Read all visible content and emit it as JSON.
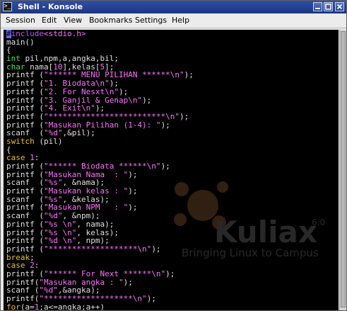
{
  "window": {
    "title": "Shell - Konsole",
    "app_icon": ">_"
  },
  "menubar": {
    "items": [
      "Session",
      "Edit",
      "View",
      "Bookmarks",
      "Settings",
      "Help"
    ]
  },
  "watermark": {
    "brand": "Kuliax",
    "version": "6.0",
    "tagline": "Bringing Linux to Campus"
  },
  "terminal": {
    "lines": [
      [
        [
          "pre-cursor",
          "#"
        ],
        [
          "pre",
          "include"
        ],
        [
          "str",
          "<stdio.h>"
        ]
      ],
      [
        [
          "plain",
          "main()"
        ]
      ],
      [
        [
          "plain",
          "{"
        ]
      ],
      [
        [
          "type",
          "int"
        ],
        [
          "plain",
          " pil,npm,a,angka,bil;"
        ]
      ],
      [
        [
          "type",
          "char"
        ],
        [
          "plain",
          " nama["
        ],
        [
          "num",
          "10"
        ],
        [
          "plain",
          "],kelas["
        ],
        [
          "num",
          "5"
        ],
        [
          "plain",
          "];"
        ]
      ],
      [
        [
          "plain",
          "printf ("
        ],
        [
          "str",
          "\"****** MENU PILIHAN ******\\n\""
        ],
        [
          "plain",
          ");"
        ]
      ],
      [
        [
          "plain",
          "printf ("
        ],
        [
          "str",
          "\"1. Biodata\\n\""
        ],
        [
          "plain",
          ");"
        ]
      ],
      [
        [
          "plain",
          "printf ("
        ],
        [
          "str",
          "\"2. For Nesxt\\n\""
        ],
        [
          "plain",
          ");"
        ]
      ],
      [
        [
          "plain",
          "printf ("
        ],
        [
          "str",
          "\"3. Ganjil & Genap\\n\""
        ],
        [
          "plain",
          ");"
        ]
      ],
      [
        [
          "plain",
          "printf ("
        ],
        [
          "str",
          "\"4. Exit\\n\""
        ],
        [
          "plain",
          ");"
        ]
      ],
      [
        [
          "plain",
          "printf ("
        ],
        [
          "str",
          "\"*************************\\n\""
        ],
        [
          "plain",
          ");"
        ]
      ],
      [
        [
          "plain",
          "printf ("
        ],
        [
          "str",
          "\"Masukan Pilihan (1-4): \""
        ],
        [
          "plain",
          ");"
        ]
      ],
      [
        [
          "plain",
          "scanf  ("
        ],
        [
          "str",
          "\"%d\""
        ],
        [
          "plain",
          ",&pil);"
        ]
      ],
      [
        [
          "kw",
          "switch"
        ],
        [
          "plain",
          " (pil)"
        ]
      ],
      [
        [
          "plain",
          "{"
        ]
      ],
      [
        [
          "kw",
          "case"
        ],
        [
          "plain",
          " "
        ],
        [
          "num",
          "1"
        ],
        [
          "plain",
          ":"
        ]
      ],
      [
        [
          "plain",
          "printf ("
        ],
        [
          "str",
          "\"****** Biodata ******\\n\""
        ],
        [
          "plain",
          ");"
        ]
      ],
      [
        [
          "plain",
          "printf ("
        ],
        [
          "str",
          "\"Masukan Nama  : \""
        ],
        [
          "plain",
          ");"
        ]
      ],
      [
        [
          "plain",
          "scanf  ("
        ],
        [
          "str",
          "\"%s\""
        ],
        [
          "plain",
          ", &nama);"
        ]
      ],
      [
        [
          "plain",
          "printf ("
        ],
        [
          "str",
          "\"Masukan kelas : \""
        ],
        [
          "plain",
          ");"
        ]
      ],
      [
        [
          "plain",
          "scanf  ("
        ],
        [
          "str",
          "\"%s\""
        ],
        [
          "plain",
          ", &kelas);"
        ]
      ],
      [
        [
          "plain",
          "printf ("
        ],
        [
          "str",
          "\"Masukan NPM   : \""
        ],
        [
          "plain",
          ");"
        ]
      ],
      [
        [
          "plain",
          "scanf  ("
        ],
        [
          "str",
          "\"%d\""
        ],
        [
          "plain",
          ", &npm);"
        ]
      ],
      [
        [
          "plain",
          "printf ("
        ],
        [
          "str",
          "\"%s \\n\""
        ],
        [
          "plain",
          ", nama);"
        ]
      ],
      [
        [
          "plain",
          "printf ("
        ],
        [
          "str",
          "\"%s \\n\""
        ],
        [
          "plain",
          ", kelas);"
        ]
      ],
      [
        [
          "plain",
          "printf ("
        ],
        [
          "str",
          "\"%d \\n\""
        ],
        [
          "plain",
          ", npm);"
        ]
      ],
      [
        [
          "plain",
          "printf ("
        ],
        [
          "str",
          "\"*******************\\n\""
        ],
        [
          "plain",
          ");"
        ]
      ],
      [
        [
          "kw",
          "break"
        ],
        [
          "plain",
          ";"
        ]
      ],
      [
        [
          "kw",
          "case"
        ],
        [
          "plain",
          " "
        ],
        [
          "num",
          "2"
        ],
        [
          "plain",
          ":"
        ]
      ],
      [
        [
          "plain",
          "printf ("
        ],
        [
          "str",
          "\"****** For Next ******\\n\""
        ],
        [
          "plain",
          ");"
        ]
      ],
      [
        [
          "plain",
          "printf("
        ],
        [
          "str",
          "\"Masukan angka : \""
        ],
        [
          "plain",
          ");"
        ]
      ],
      [
        [
          "plain",
          "scanf ("
        ],
        [
          "str",
          "\"%d\""
        ],
        [
          "plain",
          ",&angka);"
        ]
      ],
      [
        [
          "plain",
          "printf("
        ],
        [
          "str",
          "\"*******************\\n\""
        ],
        [
          "plain",
          ");"
        ]
      ],
      [
        [
          "kw",
          "for"
        ],
        [
          "plain",
          "(a="
        ],
        [
          "num",
          "1"
        ],
        [
          "plain",
          ";a<=angka;a++)"
        ]
      ]
    ]
  },
  "colors": {
    "titlebar": "#1c3580",
    "terminal_bg": "#000000",
    "preprocessor": "#c050ff",
    "type": "#50e050",
    "string": "#ff70ff",
    "keyword": "#f0c020",
    "watermark": "#5a3a20"
  },
  "icons": {
    "minimize": "minimize-icon",
    "maximize": "maximize-icon",
    "close": "close-icon"
  }
}
